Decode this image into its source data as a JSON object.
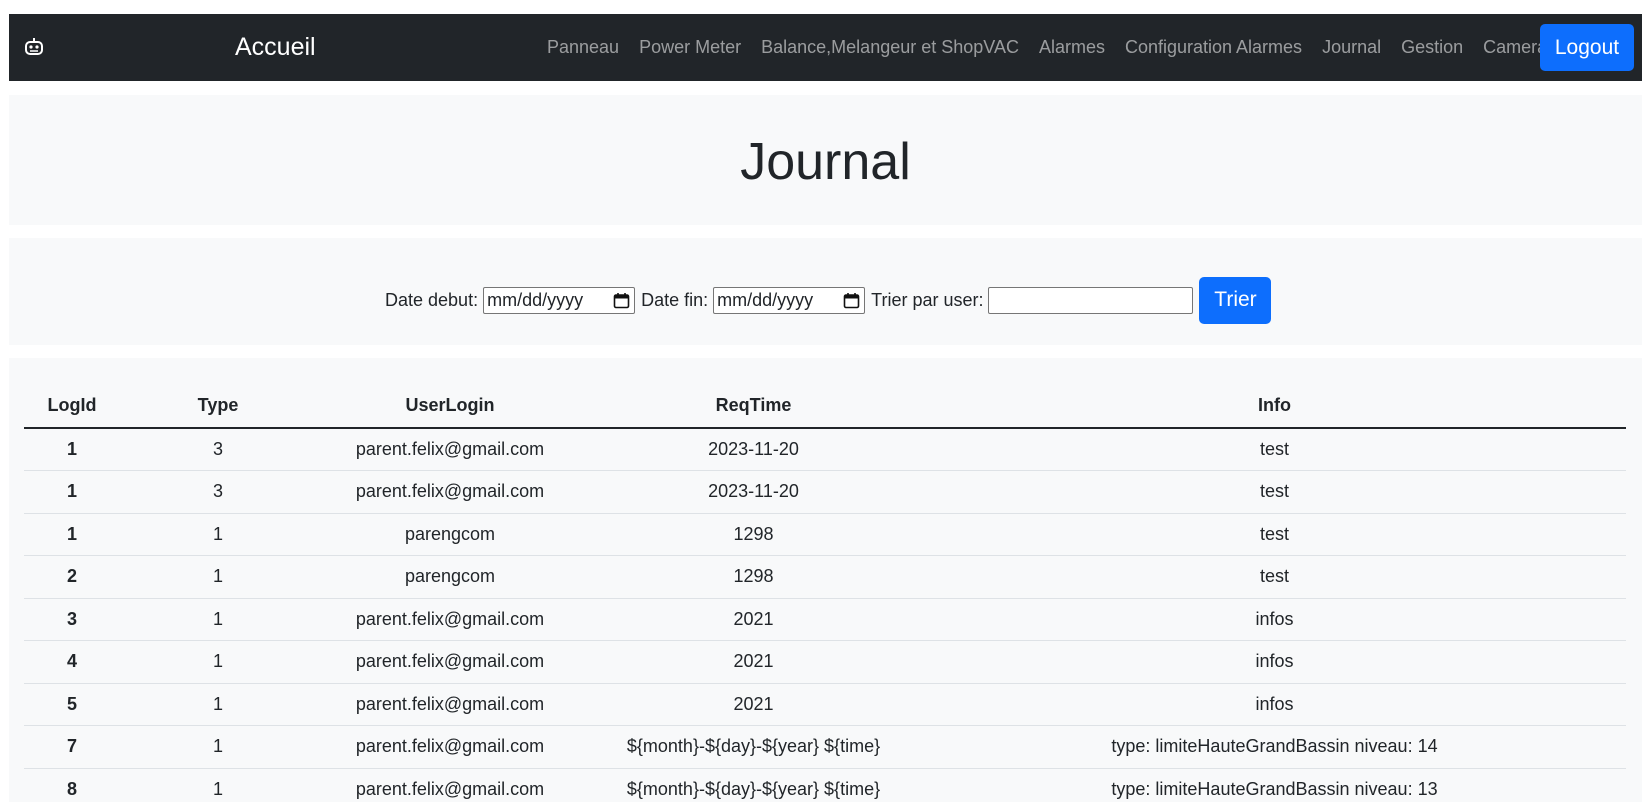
{
  "navbar": {
    "logo_icon": "robot-icon",
    "brand": "Accueil",
    "links": [
      {
        "label": "Panneau"
      },
      {
        "label": "Power Meter"
      },
      {
        "label": "Balance,Melangeur et ShopVAC"
      },
      {
        "label": "Alarmes"
      },
      {
        "label": "Configuration Alarmes"
      },
      {
        "label": "Journal"
      },
      {
        "label": "Gestion"
      },
      {
        "label": "Camera"
      }
    ],
    "logout_label": "Logout"
  },
  "page": {
    "title": "Journal"
  },
  "filters": {
    "date_debut_label": "Date debut:",
    "date_debut_value": "mm/dd/yyyy",
    "date_fin_label": "Date fin:",
    "date_fin_value": "mm/dd/yyyy",
    "user_label": "Trier par user:",
    "user_value": "",
    "submit_label": "Trier",
    "calendar_icon": "calendar-icon"
  },
  "table": {
    "headers": [
      "LogId",
      "Type",
      "UserLogin",
      "ReqTime",
      "Info"
    ],
    "rows": [
      [
        "1",
        "3",
        "parent.felix@gmail.com",
        "2023-11-20",
        "test"
      ],
      [
        "1",
        "3",
        "parent.felix@gmail.com",
        "2023-11-20",
        "test"
      ],
      [
        "1",
        "1",
        "parengcom",
        "1298",
        "test"
      ],
      [
        "2",
        "1",
        "parengcom",
        "1298",
        "test"
      ],
      [
        "3",
        "1",
        "parent.felix@gmail.com",
        "2021",
        "infos"
      ],
      [
        "4",
        "1",
        "parent.felix@gmail.com",
        "2021",
        "infos"
      ],
      [
        "5",
        "1",
        "parent.felix@gmail.com",
        "2021",
        "infos"
      ],
      [
        "7",
        "1",
        "parent.felix@gmail.com",
        "${month}-${day}-${year} ${time}",
        "type: limiteHauteGrandBassin niveau: 14"
      ],
      [
        "8",
        "1",
        "parent.felix@gmail.com",
        "${month}-${day}-${year} ${time}",
        "type: limiteHauteGrandBassin niveau: 13"
      ]
    ]
  },
  "colors": {
    "navbar_bg": "#212529",
    "primary": "#0d6efd",
    "panel_bg": "#f8f9fa"
  }
}
